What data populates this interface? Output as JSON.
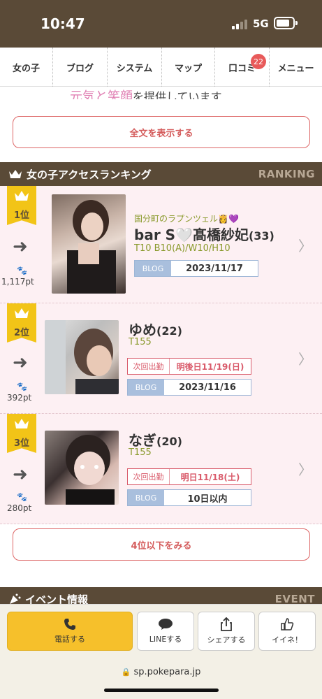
{
  "status": {
    "time": "10:47",
    "network": "5G"
  },
  "nav": {
    "items": [
      {
        "label": "女の子"
      },
      {
        "label": "ブログ"
      },
      {
        "label": "システム"
      },
      {
        "label": "マップ"
      },
      {
        "label": "口コミ",
        "badge": "22"
      },
      {
        "label": "メニュー"
      }
    ]
  },
  "intro": {
    "cut_text_pink": "元気と笑顔",
    "cut_text_rest": "を提供しています"
  },
  "buttons": {
    "show_full": "全文を表示する",
    "see_more": "4位以下をみる"
  },
  "ranking": {
    "title": "女の子アクセスランキング",
    "title_en": "RANKING",
    "rows": [
      {
        "rank": "1位",
        "points": "1,117pt",
        "catchphrase": "国分町のラプンツェル👸💜",
        "name": "bar S🤍髙橋紗妃",
        "age": "(33)",
        "specs": "T10 B10(A)/W10/H10",
        "blog_label": "BLOG",
        "blog_date": "2023/11/17"
      },
      {
        "rank": "2位",
        "points": "392pt",
        "name": "ゆめ",
        "age": "(22)",
        "specs": "T155",
        "next_label": "次回出勤",
        "next_value": "明後日11/19(日)",
        "blog_label": "BLOG",
        "blog_date": "2023/11/16"
      },
      {
        "rank": "3位",
        "points": "280pt",
        "name": "なぎ",
        "age": "(20)",
        "specs": "T155",
        "next_label": "次回出勤",
        "next_value": "明日11/18(土)",
        "blog_label": "BLOG",
        "blog_date": "10日以内"
      }
    ]
  },
  "event": {
    "title": "イベント情報",
    "title_en": "EVENT"
  },
  "toolbar": {
    "call": "電話する",
    "line": "LINEする",
    "share": "シェアする",
    "like": "イイネ！"
  },
  "browser": {
    "url": "sp.pokepara.jp"
  },
  "colors": {
    "brand_brown": "#5a4a37",
    "accent_yellow": "#f6c02b",
    "accent_red": "#d45b5b"
  }
}
